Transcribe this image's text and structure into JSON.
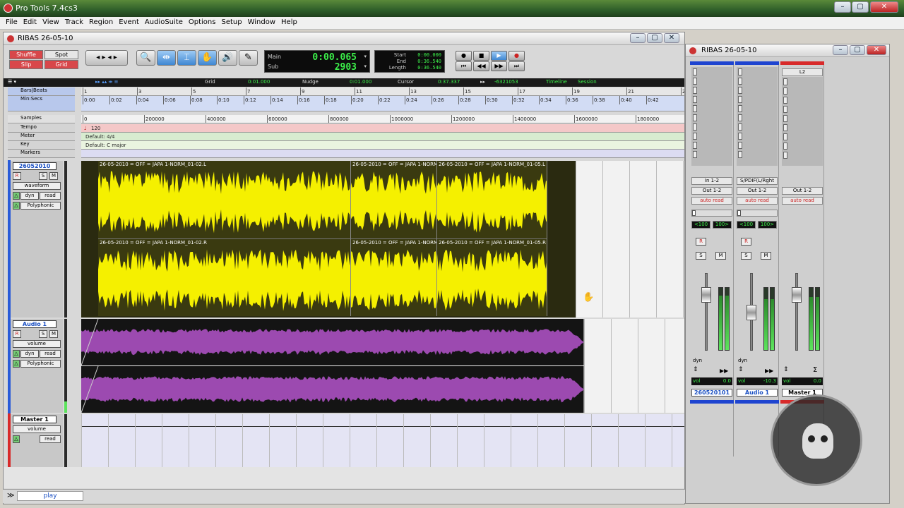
{
  "app": {
    "title": "Pro Tools 7.4cs3"
  },
  "menu": [
    "File",
    "Edit",
    "View",
    "Track",
    "Region",
    "Event",
    "AudioSuite",
    "Options",
    "Setup",
    "Window",
    "Help"
  ],
  "edit_window": {
    "title": "RIBAS 26-05-10",
    "modes": {
      "shuffle": "Shuffle",
      "spot": "Spot",
      "slip": "Slip",
      "grid": "Grid"
    },
    "counter": {
      "main_label": "Main",
      "main_value": "0:00.065",
      "sub_label": "Sub",
      "sub_value": "2903"
    },
    "selection": {
      "start_label": "Start",
      "start_value": "0:00.000",
      "end_label": "End",
      "end_value": "0:36.540",
      "length_label": "Length",
      "length_value": "0:36.540"
    },
    "gridbar": {
      "grid_label": "Grid",
      "grid_value": "0:01.000",
      "nudge_label": "Nudge",
      "nudge_value": "0:01.000",
      "cursor_label": "Cursor",
      "cursor_value": "0:37.337",
      "sample_value": "-6321053",
      "timeline_label": "Timeline",
      "session_label": "Session"
    },
    "rulers": {
      "bars_label": "Bars|Beats",
      "minsecs_label": "Min:Secs",
      "samples_label": "Samples",
      "tempo_label": "Tempo",
      "meter_label": "Meter",
      "key_label": "Key",
      "markers_label": "Markers",
      "bars": [
        "1",
        "3",
        "5",
        "7",
        "9",
        "11",
        "13",
        "15",
        "17",
        "19",
        "21",
        "23"
      ],
      "minsecs": [
        "0:00",
        "0:02",
        "0:04",
        "0:06",
        "0:08",
        "0:10",
        "0:12",
        "0:14",
        "0:16",
        "0:18",
        "0:20",
        "0:22",
        "0:24",
        "0:26",
        "0:28",
        "0:30",
        "0:32",
        "0:34",
        "0:36",
        "0:38",
        "0:40",
        "0:42"
      ],
      "samples": [
        "0",
        "200000",
        "400000",
        "600000",
        "800000",
        "1000000",
        "1200000",
        "1400000",
        "1600000",
        "1800000"
      ],
      "tempo_value": "120",
      "meter_value": "Default: 4/4",
      "key_value": "Default: C major"
    },
    "tracks": [
      {
        "name": "26052010",
        "r": "R",
        "s": "S",
        "m": "M",
        "view": "waveform",
        "auto_mode": "dyn",
        "auto_state": "read",
        "voice": "Polyphonic",
        "regions_l": [
          "26-05-2010 = OFF = JAPA 1-NORM_01-02.L",
          "26-05-2010 = OFF = JAPA 1-NORM_01-04.L",
          "26-05-2010 = OFF = JAPA 1-NORM_01-05.L"
        ],
        "regions_r": [
          "26-05-2010 = OFF = JAPA 1-NORM_01-02.R",
          "26-05-2010 = OFF = JAPA 1-NORM_01-04.R",
          "26-05-2010 = OFF = JAPA 1-NORM_01-05.R"
        ]
      },
      {
        "name": "Audio 1",
        "r": "R",
        "s": "S",
        "m": "M",
        "view": "volume",
        "auto_mode": "dyn",
        "auto_state": "read",
        "voice": "Polyphonic"
      },
      {
        "name": "Master 1",
        "view": "volume",
        "auto_state": "read"
      }
    ],
    "status": {
      "play_label": "play"
    }
  },
  "mix_window": {
    "title": "RIBAS 26-05-10",
    "strips": [
      {
        "insert_top": "",
        "input": "In 1-2",
        "output": "Out 1-2",
        "auto": "auto read",
        "pan_l": "<100",
        "pan_r": "100>",
        "r": "R",
        "s": "S",
        "m": "M",
        "dyn": "dyn",
        "vol_label": "vol",
        "vol_value": "0.0",
        "name": "260520101",
        "meter_level": 0.88
      },
      {
        "insert_top": "",
        "input": "S/PDIF(L/Rght",
        "output": "Out 1-2",
        "auto": "auto read",
        "pan_l": "<100",
        "pan_r": "100>",
        "r": "R",
        "s": "S",
        "m": "M",
        "dyn": "dyn",
        "vol_label": "vol",
        "vol_value": "-10.3",
        "name": "Audio 1",
        "meter_level": 0.82
      },
      {
        "insert_top": "L2",
        "input": "",
        "output": "Out 1-2",
        "auto": "auto read",
        "vol_label": "vol",
        "vol_value": "0.0",
        "name": "Master 1",
        "meter_level": 0.85
      }
    ]
  },
  "colors": {
    "region_yellow": "#f5f000",
    "region_purple": "#9c4ab0",
    "accent_red": "#d8474a",
    "counter_green": "#3cf04a"
  }
}
